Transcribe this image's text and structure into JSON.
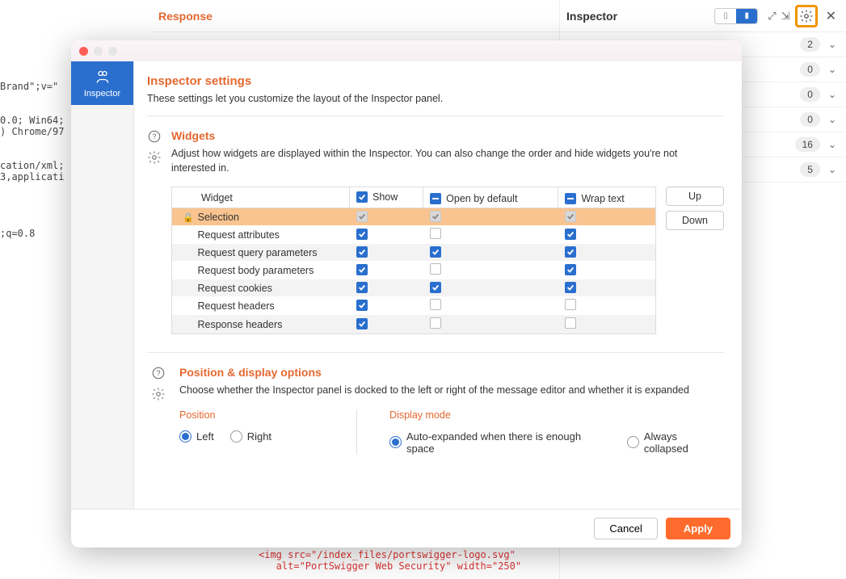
{
  "background": {
    "response_title": "Response",
    "code_left": "Brand\";v=\"\n\n\n0.0; Win64;\n) Chrome/97\n\n\ncation/xml;\n3,applicati\n\n\n\n\n;q=0.8",
    "bottom_code": "<img src=\"/index_files/portswigger-logo.svg\"\n   alt=\"PortSwigger Web Security\" width=\"250\"",
    "inspector": {
      "title": "Inspector",
      "rows": [
        {
          "count": 2
        },
        {
          "count": 0
        },
        {
          "count": 0
        },
        {
          "count": 0
        },
        {
          "count": 16
        },
        {
          "count": 5
        }
      ]
    }
  },
  "modal": {
    "sidebar": {
      "item_label": "Inspector"
    },
    "title": "Inspector settings",
    "intro": "These settings let you customize the layout of the Inspector panel.",
    "widgets": {
      "heading": "Widgets",
      "desc": "Adjust how widgets are displayed within the Inspector. You can also change the order and hide widgets you're not interested in.",
      "columns": {
        "widget": "Widget",
        "show": "Show",
        "open": "Open by default",
        "wrap": "Wrap text"
      },
      "header_state": {
        "show": "check",
        "open": "minus",
        "wrap": "minus"
      },
      "rows": [
        {
          "name": "Selection",
          "locked": true,
          "show": true,
          "open": true,
          "wrap": true
        },
        {
          "name": "Request attributes",
          "locked": false,
          "show": true,
          "open": false,
          "wrap": true
        },
        {
          "name": "Request query parameters",
          "locked": false,
          "show": true,
          "open": true,
          "wrap": true
        },
        {
          "name": "Request body parameters",
          "locked": false,
          "show": true,
          "open": false,
          "wrap": true
        },
        {
          "name": "Request cookies",
          "locked": false,
          "show": true,
          "open": true,
          "wrap": true
        },
        {
          "name": "Request headers",
          "locked": false,
          "show": true,
          "open": false,
          "wrap": false
        },
        {
          "name": "Response headers",
          "locked": false,
          "show": true,
          "open": false,
          "wrap": false
        }
      ],
      "buttons": {
        "up": "Up",
        "down": "Down"
      }
    },
    "position": {
      "heading": "Position & display options",
      "desc": "Choose whether the Inspector panel is docked to the left or right of the message editor and whether it is expanded",
      "pos_label": "Position",
      "pos_left": "Left",
      "pos_right": "Right",
      "pos_selected": "Left",
      "mode_label": "Display mode",
      "mode_auto": "Auto-expanded when there is enough space",
      "mode_collapsed": "Always collapsed",
      "mode_selected": "auto"
    },
    "footer": {
      "cancel": "Cancel",
      "apply": "Apply"
    }
  }
}
